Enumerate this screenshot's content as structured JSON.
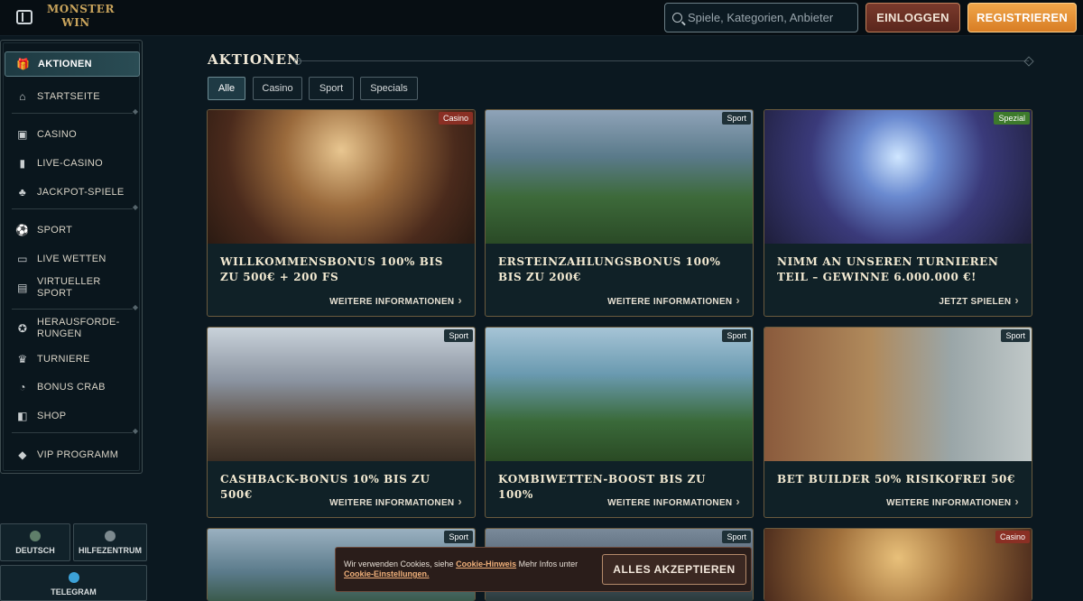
{
  "header": {
    "logo_line1": "MONSTER",
    "logo_line2": "WIN",
    "search_placeholder": "Spiele, Kategorien, Anbieter",
    "login_label": "EINLOGGEN",
    "register_label": "REGISTRIEREN"
  },
  "sidebar": {
    "items": [
      {
        "label": "AKTIONEN",
        "icon": "gift-icon"
      },
      {
        "label": "STARTSEITE",
        "icon": "home-icon"
      },
      {
        "label": "CASINO",
        "icon": "slot-machine-icon"
      },
      {
        "label": "LIVE-CASINO",
        "icon": "cards-icon"
      },
      {
        "label": "JACKPOT-SPIELE",
        "icon": "clover-icon"
      },
      {
        "label": "SPORT",
        "icon": "ball-icon"
      },
      {
        "label": "LIVE WETTEN",
        "icon": "live-icon"
      },
      {
        "label": "VIRTUELLER SPORT",
        "icon": "monitor-icon"
      },
      {
        "label": "HERAUSFORDE-RUNGEN",
        "icon": "badge-icon"
      },
      {
        "label": "TURNIERE",
        "icon": "trophy-icon"
      },
      {
        "label": "BONUS CRAB",
        "icon": "crab-icon"
      },
      {
        "label": "SHOP",
        "icon": "bag-icon"
      },
      {
        "label": "VIP PROGRAMM",
        "icon": "diamond-icon"
      }
    ],
    "language_label": "DEUTSCH",
    "help_label": "HILFEZENTRUM",
    "telegram_label": "TELEGRAM"
  },
  "main": {
    "title": "AKTIONEN",
    "tabs": [
      "Alle",
      "Casino",
      "Sport",
      "Specials"
    ],
    "cards": [
      {
        "badge": "Casino",
        "title": "WILLKOMMENSBONUS 100% BIS ZU 500€ + 200 FS",
        "cta": "WEITERE INFORMATIONEN"
      },
      {
        "badge": "Sport",
        "title": "ERSTEINZAHLUNGSBONUS 100% BIS ZU 200€",
        "cta": "WEITERE INFORMATIONEN"
      },
      {
        "badge": "Spezial",
        "title": "NIMM AN UNSEREN TURNIEREN TEIL – GEWINNE 6.000.000 €!",
        "cta": "JETZT SPIELEN"
      },
      {
        "badge": "Sport",
        "title": "CASHBACK-BONUS 10% BIS ZU 500€",
        "cta": "WEITERE INFORMATIONEN"
      },
      {
        "badge": "Sport",
        "title": "KOMBIWETTEN-BOOST BIS ZU 100%",
        "cta": "WEITERE INFORMATIONEN"
      },
      {
        "badge": "Sport",
        "title": "BET BUILDER 50% RISIKOFREI 50€",
        "cta": "WEITERE INFORMATIONEN"
      },
      {
        "badge": "Sport",
        "title": "",
        "cta": ""
      },
      {
        "badge": "Sport",
        "title": "",
        "cta": ""
      },
      {
        "badge": "Casino",
        "title": "",
        "cta": ""
      }
    ]
  },
  "cookie": {
    "text_1": "Wir verwenden Cookies, siehe",
    "link_1": "Cookie-Hinweis",
    "text_2": "Mehr Infos unter",
    "link_2": "Cookie-Einstellungen.",
    "accept_label": "ALLES AKZEPTIEREN"
  },
  "colors": {
    "badge_casino": "#8a2f24",
    "badge_sport": "#1f3138",
    "badge_spezial": "#3d7a2c",
    "accent_orange": "#e8902f",
    "gold": "#c9a45c"
  }
}
